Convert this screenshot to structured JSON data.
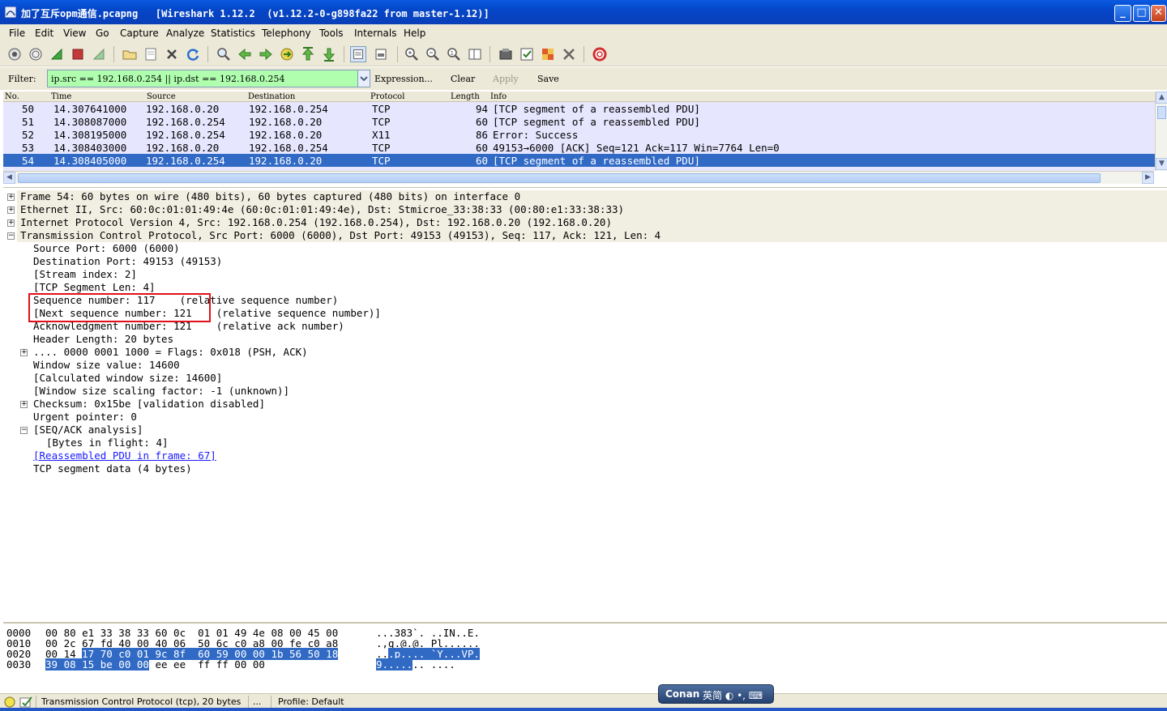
{
  "window": {
    "title": "加了互斥opm通信.pcapng   [Wireshark 1.12.2  (v1.12.2-0-g898fa22 from master-1.12)]",
    "minimize_label": "_",
    "maximize_label": "□",
    "close_label": "✕"
  },
  "menu": {
    "items": [
      {
        "label": "File",
        "key": "F"
      },
      {
        "label": "Edit",
        "key": "E"
      },
      {
        "label": "View",
        "key": "V"
      },
      {
        "label": "Go",
        "key": "G"
      },
      {
        "label": "Capture",
        "key": "C"
      },
      {
        "label": "Analyze",
        "key": "A"
      },
      {
        "label": "Statistics",
        "key": "S"
      },
      {
        "label": "Telephony",
        "key": "y"
      },
      {
        "label": "Tools",
        "key": "T"
      },
      {
        "label": "Internals",
        "key": "I"
      },
      {
        "label": "Help",
        "key": "H"
      }
    ]
  },
  "toolbar": {
    "icons": [
      "interfaces-icon",
      "options-icon",
      "start-capture-icon",
      "stop-capture-icon",
      "restart-capture-icon",
      "open-file-icon",
      "save-file-icon",
      "close-file-icon",
      "reload-icon",
      "find-icon",
      "back-icon",
      "forward-icon",
      "goto-icon",
      "first-packet-icon",
      "last-packet-icon",
      "colorize-icon",
      "autoscroll-icon",
      "zoom-in-icon",
      "zoom-out-icon",
      "normal-size-icon",
      "resize-columns-icon",
      "capture-filters-icon",
      "display-filters-icon",
      "coloring-rules-icon",
      "preferences-icon",
      "help-icon"
    ]
  },
  "filter": {
    "label": "Filter:",
    "value": "ip.src == 192.168.0.254 || ip.dst == 192.168.0.254",
    "expression_label": "Expression...",
    "clear_label": "Clear",
    "apply_label": "Apply",
    "save_label": "Save"
  },
  "packet_list": {
    "columns": [
      "No.",
      "Time",
      "Source",
      "Destination",
      "Protocol",
      "Length",
      "Info"
    ],
    "rows": [
      {
        "no": "50",
        "time": "14.307641000",
        "src": "192.168.0.20",
        "dst": "192.168.0.254",
        "proto": "TCP",
        "len": "94",
        "info": "[TCP segment of a reassembled PDU]",
        "selected": false
      },
      {
        "no": "51",
        "time": "14.308087000",
        "src": "192.168.0.254",
        "dst": "192.168.0.20",
        "proto": "TCP",
        "len": "60",
        "info": "[TCP segment of a reassembled PDU]",
        "selected": false
      },
      {
        "no": "52",
        "time": "14.308195000",
        "src": "192.168.0.254",
        "dst": "192.168.0.20",
        "proto": "X11",
        "len": "86",
        "info": "Error: Success",
        "selected": false
      },
      {
        "no": "53",
        "time": "14.308403000",
        "src": "192.168.0.20",
        "dst": "192.168.0.254",
        "proto": "TCP",
        "len": "60",
        "info": "49153→6000 [ACK] Seq=121 Ack=117 Win=7764 Len=0",
        "selected": false
      },
      {
        "no": "54",
        "time": "14.308405000",
        "src": "192.168.0.254",
        "dst": "192.168.0.20",
        "proto": "TCP",
        "len": "60",
        "info": "[TCP segment of a reassembled PDU]",
        "selected": true
      }
    ]
  },
  "details": {
    "lines": [
      {
        "text": "Frame 54: 60 bytes on wire (480 bits), 60 bytes captured (480 bits) on interface 0",
        "indent": 0,
        "expander": "+",
        "highlight": true,
        "link": false
      },
      {
        "text": "Ethernet II, Src: 60:0c:01:01:49:4e (60:0c:01:01:49:4e), Dst: Stmicroe_33:38:33 (00:80:e1:33:38:33)",
        "indent": 0,
        "expander": "+",
        "highlight": true,
        "link": false
      },
      {
        "text": "Internet Protocol Version 4, Src: 192.168.0.254 (192.168.0.254), Dst: 192.168.0.20 (192.168.0.20)",
        "indent": 0,
        "expander": "+",
        "highlight": true,
        "link": false
      },
      {
        "text": "Transmission Control Protocol, Src Port: 6000 (6000), Dst Port: 49153 (49153), Seq: 117, Ack: 121, Len: 4",
        "indent": 0,
        "expander": "-",
        "highlight": true,
        "link": false
      },
      {
        "text": "Source Port: 6000 (6000)",
        "indent": 1,
        "expander": "",
        "highlight": false,
        "link": false
      },
      {
        "text": "Destination Port: 49153 (49153)",
        "indent": 1,
        "expander": "",
        "highlight": false,
        "link": false
      },
      {
        "text": "[Stream index: 2]",
        "indent": 1,
        "expander": "",
        "highlight": false,
        "link": false
      },
      {
        "text": "[TCP Segment Len: 4]",
        "indent": 1,
        "expander": "",
        "highlight": false,
        "link": false
      },
      {
        "text": "Sequence number: 117    (relative sequence number)",
        "indent": 1,
        "expander": "",
        "highlight": false,
        "link": false
      },
      {
        "text": "[Next sequence number: 121    (relative sequence number)]",
        "indent": 1,
        "expander": "",
        "highlight": false,
        "link": false
      },
      {
        "text": "Acknowledgment number: 121    (relative ack number)",
        "indent": 1,
        "expander": "",
        "highlight": false,
        "link": false
      },
      {
        "text": "Header Length: 20 bytes",
        "indent": 1,
        "expander": "",
        "highlight": false,
        "link": false
      },
      {
        "text": ".... 0000 0001 1000 = Flags: 0x018 (PSH, ACK)",
        "indent": 1,
        "expander": "+",
        "highlight": false,
        "link": false
      },
      {
        "text": "Window size value: 14600",
        "indent": 1,
        "expander": "",
        "highlight": false,
        "link": false
      },
      {
        "text": "[Calculated window size: 14600]",
        "indent": 1,
        "expander": "",
        "highlight": false,
        "link": false
      },
      {
        "text": "[Window size scaling factor: -1 (unknown)]",
        "indent": 1,
        "expander": "",
        "highlight": false,
        "link": false
      },
      {
        "text": "Checksum: 0x15be [validation disabled]",
        "indent": 1,
        "expander": "+",
        "highlight": false,
        "link": false
      },
      {
        "text": "Urgent pointer: 0",
        "indent": 1,
        "expander": "",
        "highlight": false,
        "link": false
      },
      {
        "text": "[SEQ/ACK analysis]",
        "indent": 1,
        "expander": "-",
        "highlight": false,
        "link": false
      },
      {
        "text": "[Bytes in flight: 4]",
        "indent": 2,
        "expander": "",
        "highlight": false,
        "link": false
      },
      {
        "text": "[Reassembled PDU in frame: 67]",
        "indent": 1,
        "expander": "",
        "highlight": false,
        "link": true
      },
      {
        "text": "TCP segment data (4 bytes)",
        "indent": 1,
        "expander": "",
        "highlight": false,
        "link": false
      }
    ]
  },
  "hex": {
    "lines": [
      {
        "offset": "0000",
        "pre": "00 80 e1 33 38 33 60 0c  01 01 49 4e 08 00 45 00",
        "sel": "",
        "post": "",
        "ascii_pre": "...383`. ..IN..E.",
        "ascii_sel": "",
        "ascii_post": ""
      },
      {
        "offset": "0010",
        "pre": "00 2c 67 fd 40 00 40 06  50 6c c0 a8 00 fe c0 a8",
        "sel": "",
        "post": "",
        "ascii_pre": ".,g.@.@. Pl......",
        "ascii_sel": "",
        "ascii_post": ""
      },
      {
        "offset": "0020",
        "pre": "00 14 ",
        "sel": "17 70 c0 01 9c 8f  60 59 00 00 1b 56 50 18",
        "post": "",
        "ascii_pre": "..",
        "ascii_sel": ".p.... `Y...VP.",
        "ascii_post": ""
      },
      {
        "offset": "0030",
        "pre": "",
        "sel": "39 08 15 be 00 00",
        "post": " ee ee  ff ff 00 00",
        "ascii_pre": "",
        "ascii_sel": "9.....",
        "ascii_post": ".. ...."
      }
    ]
  },
  "status": {
    "field_text": "Transmission Control Protocol (tcp), 20 bytes",
    "packets_text": "...",
    "profile_text": "Profile: Default"
  },
  "ime": {
    "name": "Conan",
    "indicator": "英简 ◐ •, ⌨"
  }
}
